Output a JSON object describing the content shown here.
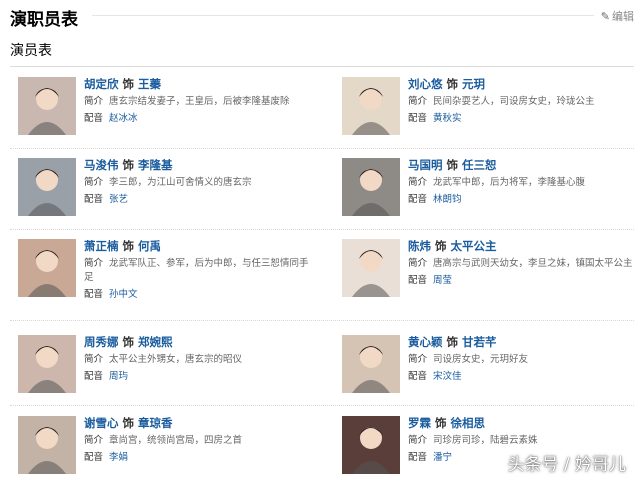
{
  "header": {
    "title": "演职员表",
    "edit_label": "编辑"
  },
  "cast_section": {
    "title": "演员表"
  },
  "labels": {
    "intro": "简介",
    "dub": "配音",
    "as": "饰"
  },
  "cast": [
    {
      "actor": "胡定欣",
      "role": "王蓁",
      "intro": "唐玄宗结发妻子，王皇后，后被李隆基废除",
      "dub": "赵冰冰"
    },
    {
      "actor": "刘心悠",
      "role": "元玥",
      "intro": "民间杂耍艺人，司设房女史，玲珑公主",
      "dub": "黄秋实"
    },
    {
      "actor": "马浚伟",
      "role": "李隆基",
      "intro": "李三郎，为江山可舍情义的唐玄宗",
      "dub": "张艺"
    },
    {
      "actor": "马国明",
      "role": "任三恕",
      "intro": "龙武军中郎，后为将军，李隆基心腹",
      "dub": "林朗钧"
    },
    {
      "actor": "萧正楠",
      "role": "何禹",
      "intro": "龙武军队正、参军，后为中郎，与任三恕情同手足",
      "dub": "孙中文"
    },
    {
      "actor": "陈炜",
      "role": "太平公主",
      "intro": "唐高宗与武则天幼女，李旦之妹，镇国太平公主",
      "dub": "周莹"
    },
    {
      "actor": "周秀娜",
      "role": "郑婉熙",
      "intro": "太平公主外甥女，唐玄宗的昭仪",
      "dub": "周玙"
    },
    {
      "actor": "黄心颖",
      "role": "甘若芊",
      "intro": "司设房女史，元玥好友",
      "dub": "宋汶佳"
    },
    {
      "actor": "谢雪心",
      "role": "章琼香",
      "intro": "章尚宫，统领尚宫局，四房之首",
      "dub": "李娟"
    },
    {
      "actor": "罗霖",
      "role": "徐相思",
      "intro": "司珍房司珍，陆碧云素姝",
      "dub": "潘宁"
    }
  ],
  "watermark": "头条号 / 妗哥儿",
  "photo_colors": [
    "#c9b8b0",
    "#e4d8c8",
    "#9aa0a8",
    "#8e8a86",
    "#c9a896",
    "#eadfd6",
    "#cdb7ad",
    "#d5c4b4",
    "#c3b3a6",
    "#5a3e3a"
  ]
}
